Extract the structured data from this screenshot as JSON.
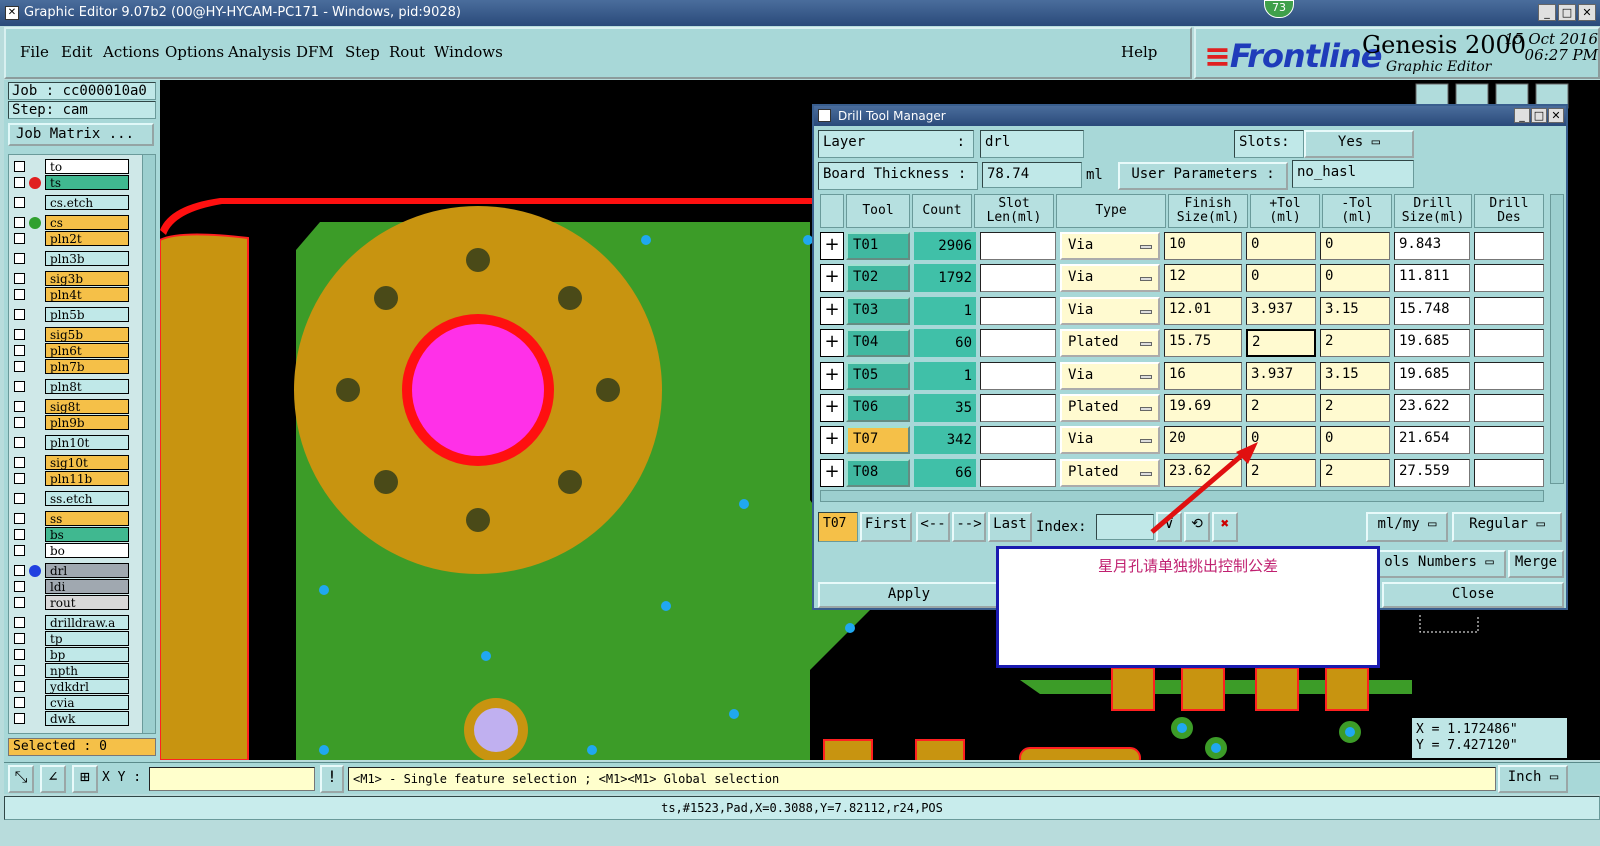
{
  "window": {
    "title": "Graphic Editor 9.07b2 (00@HY-HYCAM-PC171 - Windows, pid:9028)",
    "badge": "73"
  },
  "menu": {
    "items": [
      "File",
      "Edit",
      "Actions",
      "Options",
      "Analysis",
      "DFM",
      "Step",
      "Rout",
      "Windows"
    ],
    "help": "Help"
  },
  "brand": {
    "logo": "Frontline",
    "product": "Genesis 2000",
    "subtitle": "Graphic Editor",
    "date": "15 Oct 2016",
    "time": "06:27 PM"
  },
  "job": {
    "job_line": "Job : cc000010a0",
    "step_line": "Step: cam",
    "matrix_button": "Job Matrix ..."
  },
  "layers": [
    {
      "name": "to",
      "color": "#ffffff"
    },
    {
      "name": "ts",
      "color": "#40b890",
      "dot": "#e02020"
    },
    {
      "name": "cs.etch",
      "color": "#c0e8e8"
    },
    {
      "name": "cs",
      "color": "#f5c048",
      "dot": "#30a030"
    },
    {
      "name": "pln2t",
      "color": "#f5c048"
    },
    {
      "name": "pln3b",
      "color": "#c0e8e8"
    },
    {
      "name": "sig3b",
      "color": "#f5c048"
    },
    {
      "name": "pln4t",
      "color": "#f5c048"
    },
    {
      "name": "pln5b",
      "color": "#c0e8e8"
    },
    {
      "name": "sig5b",
      "color": "#f5c048"
    },
    {
      "name": "pln6t",
      "color": "#f5c048"
    },
    {
      "name": "pln7b",
      "color": "#f5c048"
    },
    {
      "name": "pln8t",
      "color": "#c0e8e8"
    },
    {
      "name": "sig8t",
      "color": "#f5c048"
    },
    {
      "name": "pln9b",
      "color": "#f5c048"
    },
    {
      "name": "pln10t",
      "color": "#c0e8e8"
    },
    {
      "name": "sig10t",
      "color": "#f5c048"
    },
    {
      "name": "pln11b",
      "color": "#f5c048"
    },
    {
      "name": "ss.etch",
      "color": "#c0e8e8"
    },
    {
      "name": "ss",
      "color": "#f5c048"
    },
    {
      "name": "bs",
      "color": "#40b890"
    },
    {
      "name": "bo",
      "color": "#ffffff"
    },
    {
      "name": "drl",
      "color": "#a0a8b0",
      "dot": "#2040e0"
    },
    {
      "name": "ldi",
      "color": "#a0a8b0"
    },
    {
      "name": "rout",
      "color": "#d8d8d8"
    },
    {
      "name": "drilldraw.a",
      "color": "#c0e8e8"
    },
    {
      "name": "tp",
      "color": "#c0e8e8"
    },
    {
      "name": "bp",
      "color": "#c0e8e8"
    },
    {
      "name": "npth",
      "color": "#c0e8e8"
    },
    {
      "name": "ydkdrl",
      "color": "#c0e8e8"
    },
    {
      "name": "cvia",
      "color": "#c0e8e8"
    },
    {
      "name": "dwk",
      "color": "#c0e8e8"
    }
  ],
  "selected": "Selected : 0",
  "coords": {
    "x": "X = 1.172486\"",
    "y": "Y = 7.427120\""
  },
  "bottom": {
    "xy_label": "X Y :",
    "message": "<M1> - Single feature selection ; <M1><M1> Global selection",
    "units": "Inch"
  },
  "status": "ts,#1523,Pad,X=0.3088,Y=7.82112,r24,POS",
  "dtm": {
    "title": "Drill Tool Manager",
    "layer_label": "Layer",
    "layer_colon": ":",
    "layer_value": "drl",
    "slots_label": "Slots:",
    "slots_value": "Yes",
    "thickness_label": "Board Thickness :",
    "thickness_value": "78.74",
    "thickness_unit": "ml",
    "user_params_label": "User Parameters :",
    "user_params_value": "no_hasl",
    "headers": [
      "Tool",
      "Count",
      "Slot\nLen(ml)",
      "Type",
      "Finish\nSize(ml)",
      "+Tol\n(ml)",
      "-Tol\n(ml)",
      "Drill\nSize(ml)",
      "Drill\nDes"
    ],
    "rows": [
      {
        "tool": "T01",
        "count": "2906",
        "type": "Via",
        "finish": "10",
        "ptol": "0",
        "mtol": "0",
        "drill": "9.843"
      },
      {
        "tool": "T02",
        "count": "1792",
        "type": "Via",
        "finish": "12",
        "ptol": "0",
        "mtol": "0",
        "drill": "11.811"
      },
      {
        "tool": "T03",
        "count": "1",
        "type": "Via",
        "finish": "12.01",
        "ptol": "3.937",
        "mtol": "3.15",
        "drill": "15.748"
      },
      {
        "tool": "T04",
        "count": "60",
        "type": "Plated",
        "finish": "15.75",
        "ptol": "2",
        "mtol": "2",
        "drill": "19.685"
      },
      {
        "tool": "T05",
        "count": "1",
        "type": "Via",
        "finish": "16",
        "ptol": "3.937",
        "mtol": "3.15",
        "drill": "19.685"
      },
      {
        "tool": "T06",
        "count": "35",
        "type": "Plated",
        "finish": "19.69",
        "ptol": "2",
        "mtol": "2",
        "drill": "23.622"
      },
      {
        "tool": "T07",
        "count": "342",
        "type": "Via",
        "finish": "20",
        "ptol": "0",
        "mtol": "0",
        "drill": "21.654"
      },
      {
        "tool": "T08",
        "count": "66",
        "type": "Plated",
        "finish": "23.62",
        "ptol": "2",
        "mtol": "2",
        "drill": "27.559"
      }
    ],
    "current_tool": "T07",
    "nav": {
      "first": "First",
      "prev": "<--",
      "next": "-->",
      "last": "Last",
      "index_label": "Index:"
    },
    "units_select": "ml/my",
    "mode_select": "Regular",
    "tools_numbers": "ols Numbers",
    "merge": "Merge",
    "apply": "Apply",
    "close": "Close"
  },
  "annotation": "星月孔请单独挑出控制公差"
}
